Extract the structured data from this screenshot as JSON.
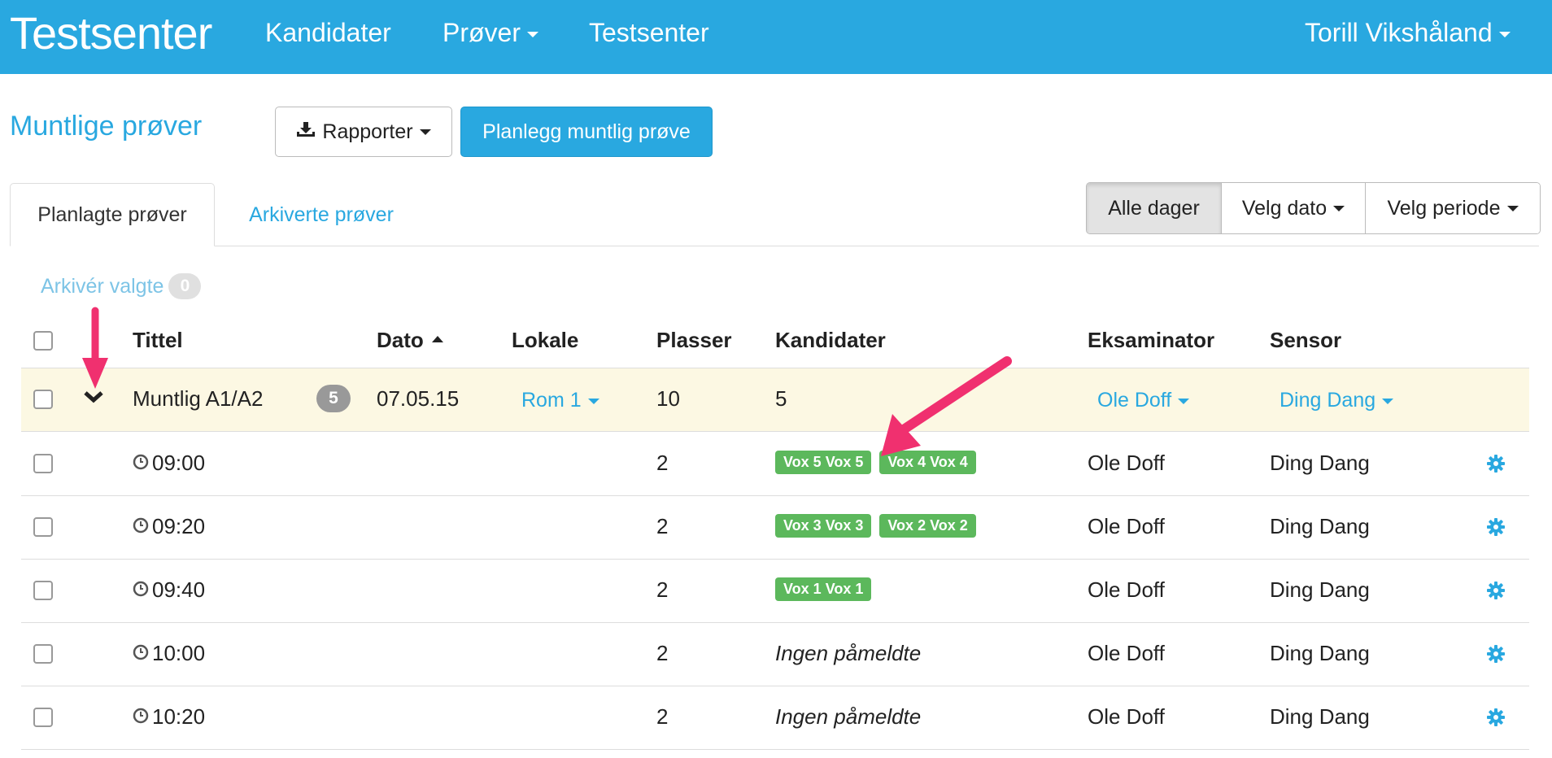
{
  "navbar": {
    "brand": "Testsenter",
    "items": [
      "Kandidater",
      "Prøver",
      "Testsenter"
    ],
    "user": "Torill Vikshåland"
  },
  "header": {
    "title": "Muntlige prøver",
    "reports_label": "Rapporter",
    "plan_label": "Planlegg muntlig prøve"
  },
  "tabs": [
    "Planlagte prøver",
    "Arkiverte prøver"
  ],
  "date_filter": [
    "Alle dager",
    "Velg dato",
    "Velg periode"
  ],
  "archive": {
    "label": "Arkivér valgte",
    "count": "0"
  },
  "table": {
    "headers": [
      "Tittel",
      "Dato",
      "Lokale",
      "Plasser",
      "Kandidater",
      "Eksaminator",
      "Sensor"
    ],
    "group": {
      "title": "Muntlig A1/A2",
      "count": "5",
      "date": "07.05.15",
      "room": "Rom 1",
      "places": "10",
      "candidates": "5",
      "examiner": "Ole Doff",
      "sensor": "Ding Dang"
    },
    "slots": [
      {
        "time": "09:00",
        "places": "2",
        "candidates": [
          "Vox 5 Vox 5",
          "Vox 4 Vox 4"
        ],
        "empty_label": "",
        "examiner": "Ole Doff",
        "sensor": "Ding Dang"
      },
      {
        "time": "09:20",
        "places": "2",
        "candidates": [
          "Vox 3 Vox 3",
          "Vox 2 Vox 2"
        ],
        "empty_label": "",
        "examiner": "Ole Doff",
        "sensor": "Ding Dang"
      },
      {
        "time": "09:40",
        "places": "2",
        "candidates": [
          "Vox 1 Vox 1"
        ],
        "empty_label": "",
        "examiner": "Ole Doff",
        "sensor": "Ding Dang"
      },
      {
        "time": "10:00",
        "places": "2",
        "candidates": [],
        "empty_label": "Ingen påmeldte",
        "examiner": "Ole Doff",
        "sensor": "Ding Dang"
      },
      {
        "time": "10:20",
        "places": "2",
        "candidates": [],
        "empty_label": "Ingen påmeldte",
        "examiner": "Ole Doff",
        "sensor": "Ding Dang"
      }
    ]
  },
  "colors": {
    "brand": "#29a8e0",
    "tag_green": "#5cb85c",
    "group_row_bg": "#fcf8e3",
    "annotation_arrow": "#f0306f"
  }
}
